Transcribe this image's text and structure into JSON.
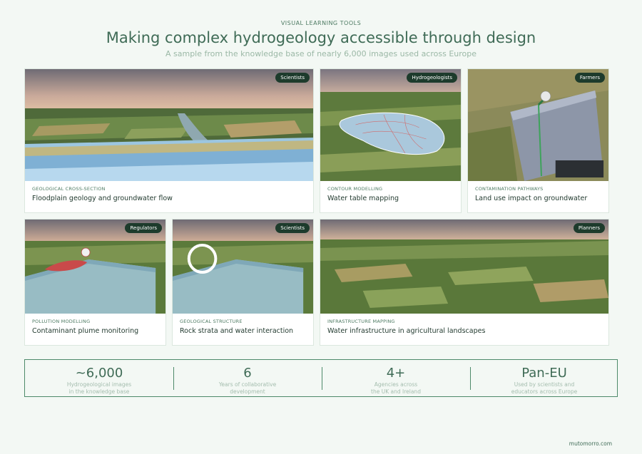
{
  "header": {
    "eyebrow": "VISUAL LEARNING TOOLS",
    "title": "Making complex hydrogeology accessible through design",
    "subtitle": "A sample from the knowledge base of nearly 6,000 images used across Europe"
  },
  "cards": [
    {
      "badge": "Scientists",
      "category": "GEOLOGICAL CROSS-SECTION",
      "title": "Floodplain geology and groundwater flow"
    },
    {
      "badge": "Hydrogeologists",
      "category": "CONTOUR MODELLING",
      "title": "Water table mapping"
    },
    {
      "badge": "Farmers",
      "category": "CONTAMINATION PATHWAYS",
      "title": "Land use impact on groundwater"
    },
    {
      "badge": "Regulators",
      "category": "POLLUTION MODELLING",
      "title": "Contaminant plume monitoring"
    },
    {
      "badge": "Scientists",
      "category": "GEOLOGICAL STRUCTURE",
      "title": "Rock strata and water interaction"
    },
    {
      "badge": "Planners",
      "category": "INFRASTRUCTURE MAPPING",
      "title": "Water infrastructure in agricultural landscapes"
    }
  ],
  "stats": [
    {
      "value": "~6,000",
      "label_line1": "Hydrogeological images",
      "label_line2": "in the knowledge base"
    },
    {
      "value": "6",
      "label_line1": "Years of collaborative",
      "label_line2": "development"
    },
    {
      "value": "4+",
      "label_line1": "Agencies across",
      "label_line2": "the UK and Ireland"
    },
    {
      "value": "Pan-EU",
      "label_line1": "Used by scientists and",
      "label_line2": "educators across Europe"
    }
  ],
  "footer": {
    "site": "mutomorro.com"
  },
  "colors": {
    "accent": "#3f6b56",
    "badge_bg": "#1d3b2c",
    "border": "#4d8a6a"
  }
}
